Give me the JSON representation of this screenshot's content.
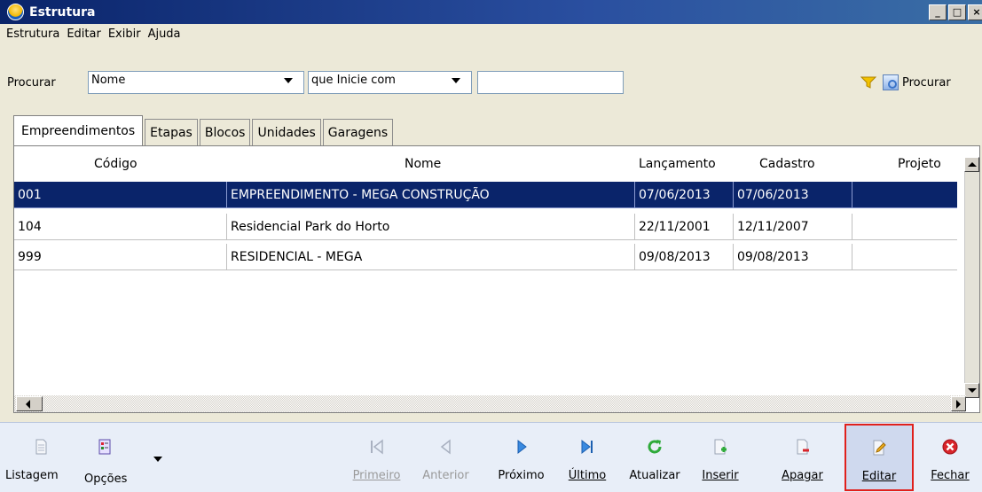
{
  "window": {
    "title": "Estrutura",
    "controls": [
      "_",
      "□",
      "×"
    ]
  },
  "menu": [
    "Estrutura",
    "Editar",
    "Exibir",
    "Ajuda"
  ],
  "search": {
    "label": "Procurar",
    "field_value": "Nome",
    "mode_value": "que Inicie com",
    "text_value": "",
    "button_label": "Procurar"
  },
  "tabs": [
    "Empreendimentos",
    "Etapas",
    "Blocos",
    "Unidades",
    "Garagens"
  ],
  "table": {
    "headers": [
      "Código",
      "Nome",
      "Lançamento",
      "Cadastro",
      "Projeto"
    ],
    "rows": [
      [
        "001",
        "EMPREENDIMENTO - MEGA CONSTRUÇÃO",
        "07/06/2013",
        "07/06/2013",
        ""
      ],
      [
        "104",
        "Residencial Park do Horto",
        "22/11/2001",
        "12/11/2007",
        ""
      ],
      [
        "999",
        "RESIDENCIAL - MEGA",
        "09/08/2013",
        "09/08/2013",
        ""
      ]
    ],
    "selected_row": 0
  },
  "toolbar": {
    "listagem": "Listagem",
    "opcoes": "Opções",
    "primeiro": "Primeiro",
    "anterior": "Anterior",
    "proximo": "Próximo",
    "ultimo": "Último",
    "atualizar": "Atualizar",
    "inserir": "Inserir",
    "apagar": "Apagar",
    "editar": "Editar",
    "fechar": "Fechar"
  },
  "colors": {
    "titlebar": "#0a246a",
    "selection": "#0a246a",
    "highlight_border": "#e0201c"
  }
}
